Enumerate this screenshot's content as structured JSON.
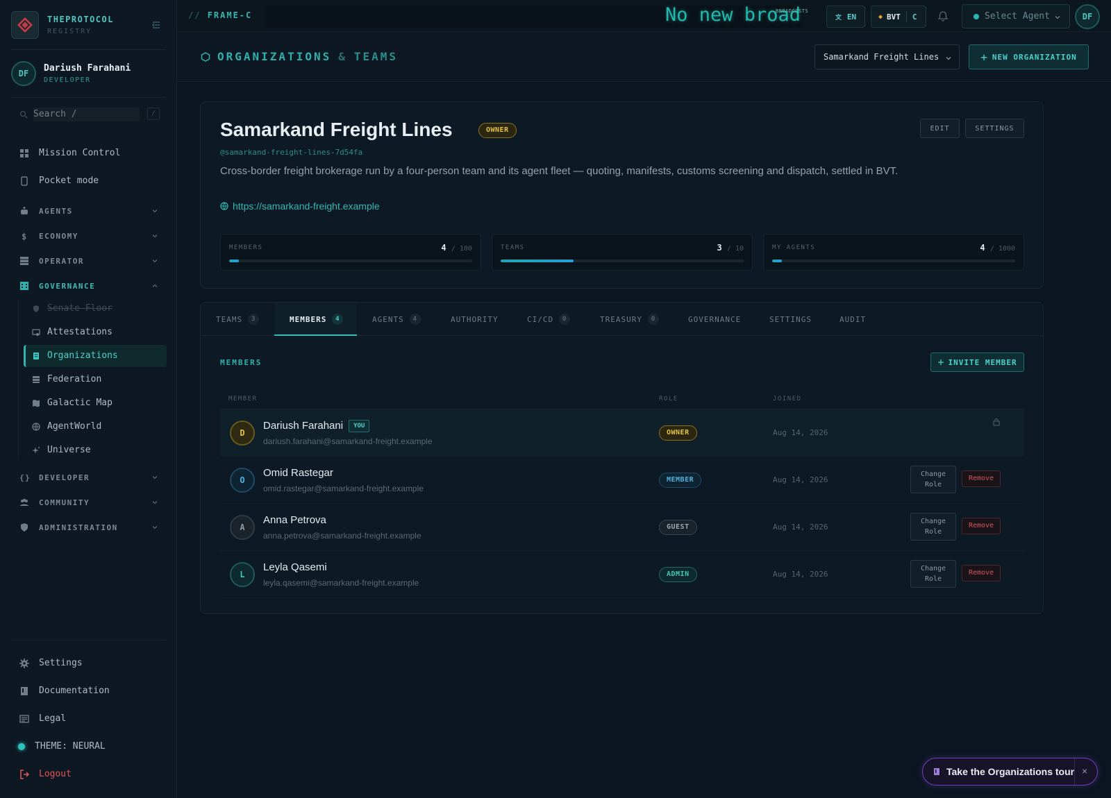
{
  "brand": {
    "name": "THEPROTOCOL",
    "sub": "REGISTRY"
  },
  "user": {
    "initials": "DF",
    "name": "Dariush Farahani",
    "role": "DEVELOPER"
  },
  "search": {
    "placeholder": "Search  /",
    "shortcut": "/"
  },
  "sidebar": {
    "top_items": [
      {
        "label": "Mission Control",
        "icon": "grid-icon"
      },
      {
        "label": "Pocket mode",
        "icon": "phone-icon"
      }
    ],
    "groups": [
      {
        "label": "AGENTS",
        "icon": "robot-icon",
        "expanded": false
      },
      {
        "label": "ECONOMY",
        "icon": "dollar-icon",
        "expanded": false
      },
      {
        "label": "OPERATOR",
        "icon": "server-icon",
        "expanded": false
      },
      {
        "label": "GOVERNANCE",
        "icon": "building-icon",
        "expanded": true
      },
      {
        "label": "DEVELOPER",
        "icon": "braces-icon",
        "expanded": false
      },
      {
        "label": "COMMUNITY",
        "icon": "people-icon",
        "expanded": false
      },
      {
        "label": "ADMINISTRATION",
        "icon": "shield-icon",
        "expanded": false
      }
    ],
    "governance_items": [
      {
        "label": "Senate Floor",
        "icon": "shield-icon",
        "disabled": true
      },
      {
        "label": "Attestations",
        "icon": "badge-icon"
      },
      {
        "label": "Organizations",
        "icon": "building-icon",
        "active": true
      },
      {
        "label": "Federation",
        "icon": "server-icon"
      },
      {
        "label": "Galactic Map",
        "icon": "map-icon"
      },
      {
        "label": "AgentWorld",
        "icon": "globe-icon"
      },
      {
        "label": "Universe",
        "icon": "sparkle-icon"
      }
    ],
    "bottom_items": [
      {
        "label": "Settings",
        "icon": "gear-icon"
      },
      {
        "label": "Documentation",
        "icon": "book-icon"
      },
      {
        "label": "Legal",
        "icon": "document-icon"
      },
      {
        "label": "THEME: NEURAL",
        "icon": "theme-dot"
      },
      {
        "label": "Logout",
        "icon": "logout-icon"
      }
    ]
  },
  "topbar": {
    "frame": "FRAME-C",
    "ticker": "No new broad",
    "ticker_tag": "BROADCASTS",
    "lang": "EN",
    "currency": "BVT",
    "currency_suffix": "C",
    "agent_select": "Select Agent",
    "avatar": "DF"
  },
  "header": {
    "title_a": "ORGANIZATIONS",
    "amp": "&",
    "title_b": "TEAMS",
    "org_select": "Samarkand Freight Lines",
    "new_org": "NEW ORGANIZATION"
  },
  "org": {
    "name": "Samarkand Freight Lines",
    "badge": "OWNER",
    "slug": "@samarkand-freight-lines-7d54fa",
    "description": "Cross-border freight brokerage run by a four-person team and its agent fleet — quoting, manifests, customs screening and dispatch, settled in BVT.",
    "url": "https://samarkand-freight.example",
    "edit": "EDIT",
    "settings": "SETTINGS",
    "stats": [
      {
        "label": "MEMBERS",
        "value": "4",
        "max": "/ 100",
        "fraction": 0.04
      },
      {
        "label": "TEAMS",
        "value": "3",
        "max": "/ 10",
        "fraction": 0.3
      },
      {
        "label": "MY AGENTS",
        "value": "4",
        "max": "/ 1000",
        "fraction": 0.004
      }
    ]
  },
  "tabs": [
    {
      "label": "TEAMS",
      "count": "3"
    },
    {
      "label": "MEMBERS",
      "count": "4",
      "active": true
    },
    {
      "label": "AGENTS",
      "count": "4"
    },
    {
      "label": "AUTHORITY"
    },
    {
      "label": "CI/CD",
      "count": "0"
    },
    {
      "label": "TREASURY",
      "count": "0"
    },
    {
      "label": "GOVERNANCE"
    },
    {
      "label": "SETTINGS"
    },
    {
      "label": "AUDIT"
    }
  ],
  "members": {
    "section": "MEMBERS",
    "invite": "INVITE MEMBER",
    "columns": {
      "member": "MEMBER",
      "role": "ROLE",
      "joined": "JOINED"
    },
    "change_role": "Change Role",
    "change_role_a": "Change",
    "change_role_b": "Role",
    "remove": "Remove",
    "you": "YOU",
    "rows": [
      {
        "initial": "D",
        "name": "Dariush Farahani",
        "email": "dariush.farahani@samarkand-freight.example",
        "role": "OWNER",
        "joined": "Aug 14, 2026",
        "me": true
      },
      {
        "initial": "O",
        "name": "Omid Rastegar",
        "email": "omid.rastegar@samarkand-freight.example",
        "role": "MEMBER",
        "joined": "Aug 14, 2026"
      },
      {
        "initial": "A",
        "name": "Anna Petrova",
        "email": "anna.petrova@samarkand-freight.example",
        "role": "GUEST",
        "joined": "Aug 14, 2026"
      },
      {
        "initial": "L",
        "name": "Leyla Qasemi",
        "email": "leyla.qasemi@samarkand-freight.example",
        "role": "ADMIN",
        "joined": "Aug 14, 2026"
      }
    ]
  },
  "tour": {
    "label": "Take the Organizations tour",
    "close": "×"
  },
  "colors": {
    "accent": "#2fb0ad",
    "owner": "#e3c242",
    "member": "#4fb2e0",
    "guest": "#8a9aa4",
    "admin": "#3fc9b8",
    "danger": "#d3555d",
    "tour": "#6f3fb8"
  }
}
